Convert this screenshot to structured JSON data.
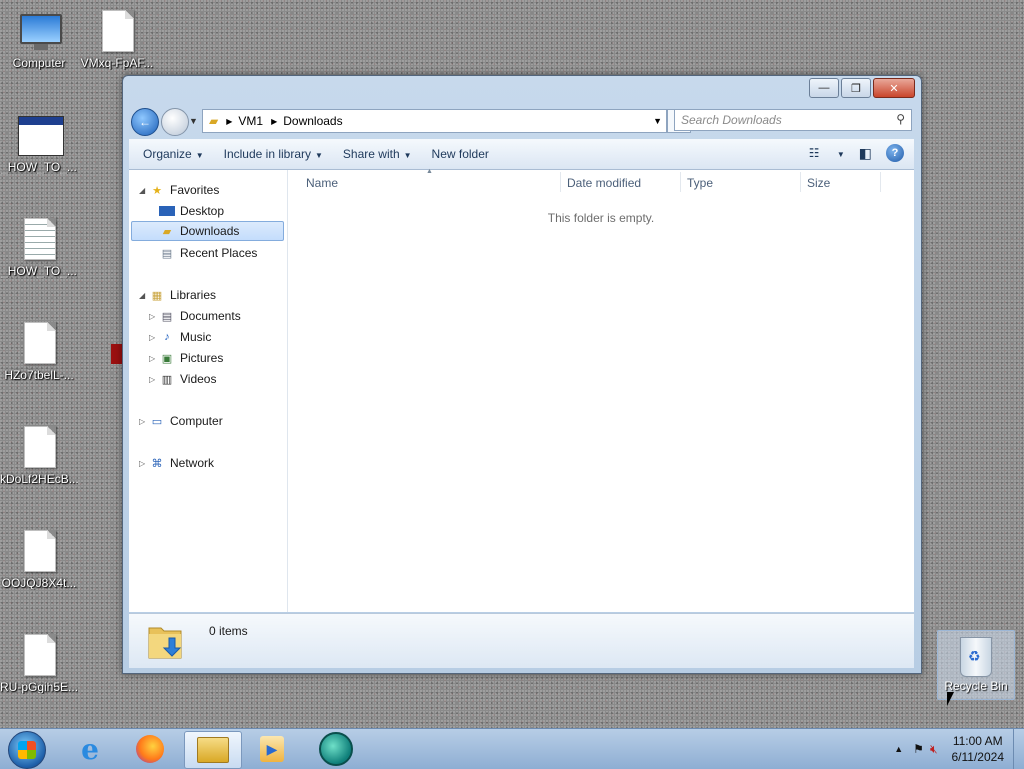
{
  "desktop": {
    "icons": [
      {
        "label": "Computer",
        "icon": "computer-icon"
      },
      {
        "label": "VMxq-FpAF...",
        "icon": "document-icon"
      },
      {
        "label": "_HOW_TO_...",
        "icon": "window-icon"
      },
      {
        "label": "_HOW_TO_...",
        "icon": "text-document-icon"
      },
      {
        "label": "HZo7tbelL-...",
        "icon": "document-icon"
      },
      {
        "label": "kDoLf2HEcB...",
        "icon": "document-icon"
      },
      {
        "label": "OOJQJ8X4t...",
        "icon": "document-icon"
      },
      {
        "label": "RU-pGgih5E...",
        "icon": "document-icon"
      }
    ],
    "recycle_bin": {
      "label": "Recycle Bin",
      "icon": "recycle-bin-icon"
    }
  },
  "explorer": {
    "caption_buttons": {
      "minimize": "—",
      "maximize": "❐",
      "close": "✕"
    },
    "address": {
      "segments": [
        "VM1",
        "Downloads"
      ]
    },
    "search": {
      "placeholder": "Search Downloads"
    },
    "toolbar": {
      "organize": "Organize",
      "include_in_library": "Include in library",
      "share_with": "Share with",
      "new_folder": "New folder"
    },
    "nav": {
      "favorites": "Favorites",
      "favorites_items": [
        "Desktop",
        "Downloads",
        "Recent Places"
      ],
      "libraries": "Libraries",
      "libraries_items": [
        "Documents",
        "Music",
        "Pictures",
        "Videos"
      ],
      "computer": "Computer",
      "network": "Network",
      "selected": "Downloads"
    },
    "columns": [
      "Name",
      "Date modified",
      "Type",
      "Size"
    ],
    "empty_message": "This folder is empty.",
    "details": {
      "item_count": "0 items"
    }
  },
  "taskbar": {
    "pinned": [
      "internet-explorer-icon",
      "firefox-icon",
      "file-explorer-icon",
      "media-player-icon",
      "app-icon"
    ],
    "active": "file-explorer-icon",
    "clock": {
      "time": "11:00 AM",
      "date": "6/11/2024"
    }
  },
  "colors": {
    "selection": "#c4ddfc",
    "window_frame": "#b7cde4",
    "taskbar": "#8eaed3"
  }
}
